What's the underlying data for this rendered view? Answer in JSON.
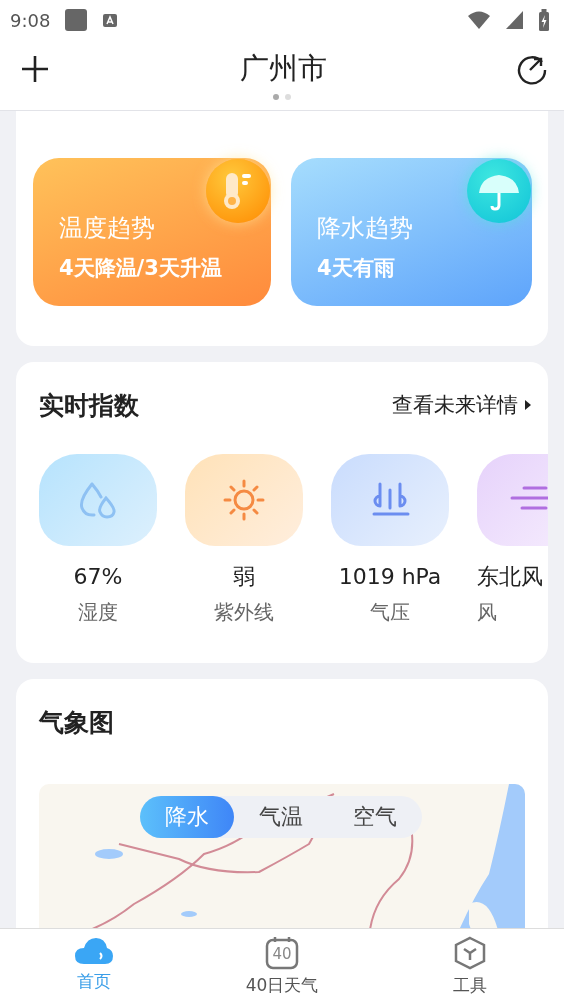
{
  "status_bar": {
    "time": "9:08"
  },
  "header": {
    "title": "广州市",
    "page_dots": [
      {
        "selected": true
      },
      {
        "selected": false
      }
    ]
  },
  "trend_cards": [
    {
      "kind": "temperature",
      "title": "温度趋势",
      "summary": "4天降温/3天升温"
    },
    {
      "kind": "rain",
      "title": "降水趋势",
      "summary": "4天有雨"
    }
  ],
  "realtime": {
    "title": "实时指数",
    "more_link": "查看未来详情",
    "items": [
      {
        "kind": "humidity",
        "value": "67%",
        "label": "湿度"
      },
      {
        "kind": "uv",
        "value": "弱",
        "label": "紫外线"
      },
      {
        "kind": "pressure",
        "value": "1019 hPa",
        "label": "气压"
      },
      {
        "kind": "wind",
        "value": "东北风",
        "label": "风"
      }
    ]
  },
  "weather_map": {
    "title": "气象图",
    "tabs": [
      {
        "label": "降水",
        "selected": true
      },
      {
        "label": "气温",
        "selected": false
      },
      {
        "label": "空气",
        "selected": false
      }
    ]
  },
  "bottom_nav": [
    {
      "kind": "home",
      "label": "首页",
      "selected": true
    },
    {
      "kind": "calendar",
      "icon_text": "40",
      "label": "40日天气",
      "selected": false
    },
    {
      "kind": "tools",
      "label": "工具",
      "selected": false
    }
  ]
}
